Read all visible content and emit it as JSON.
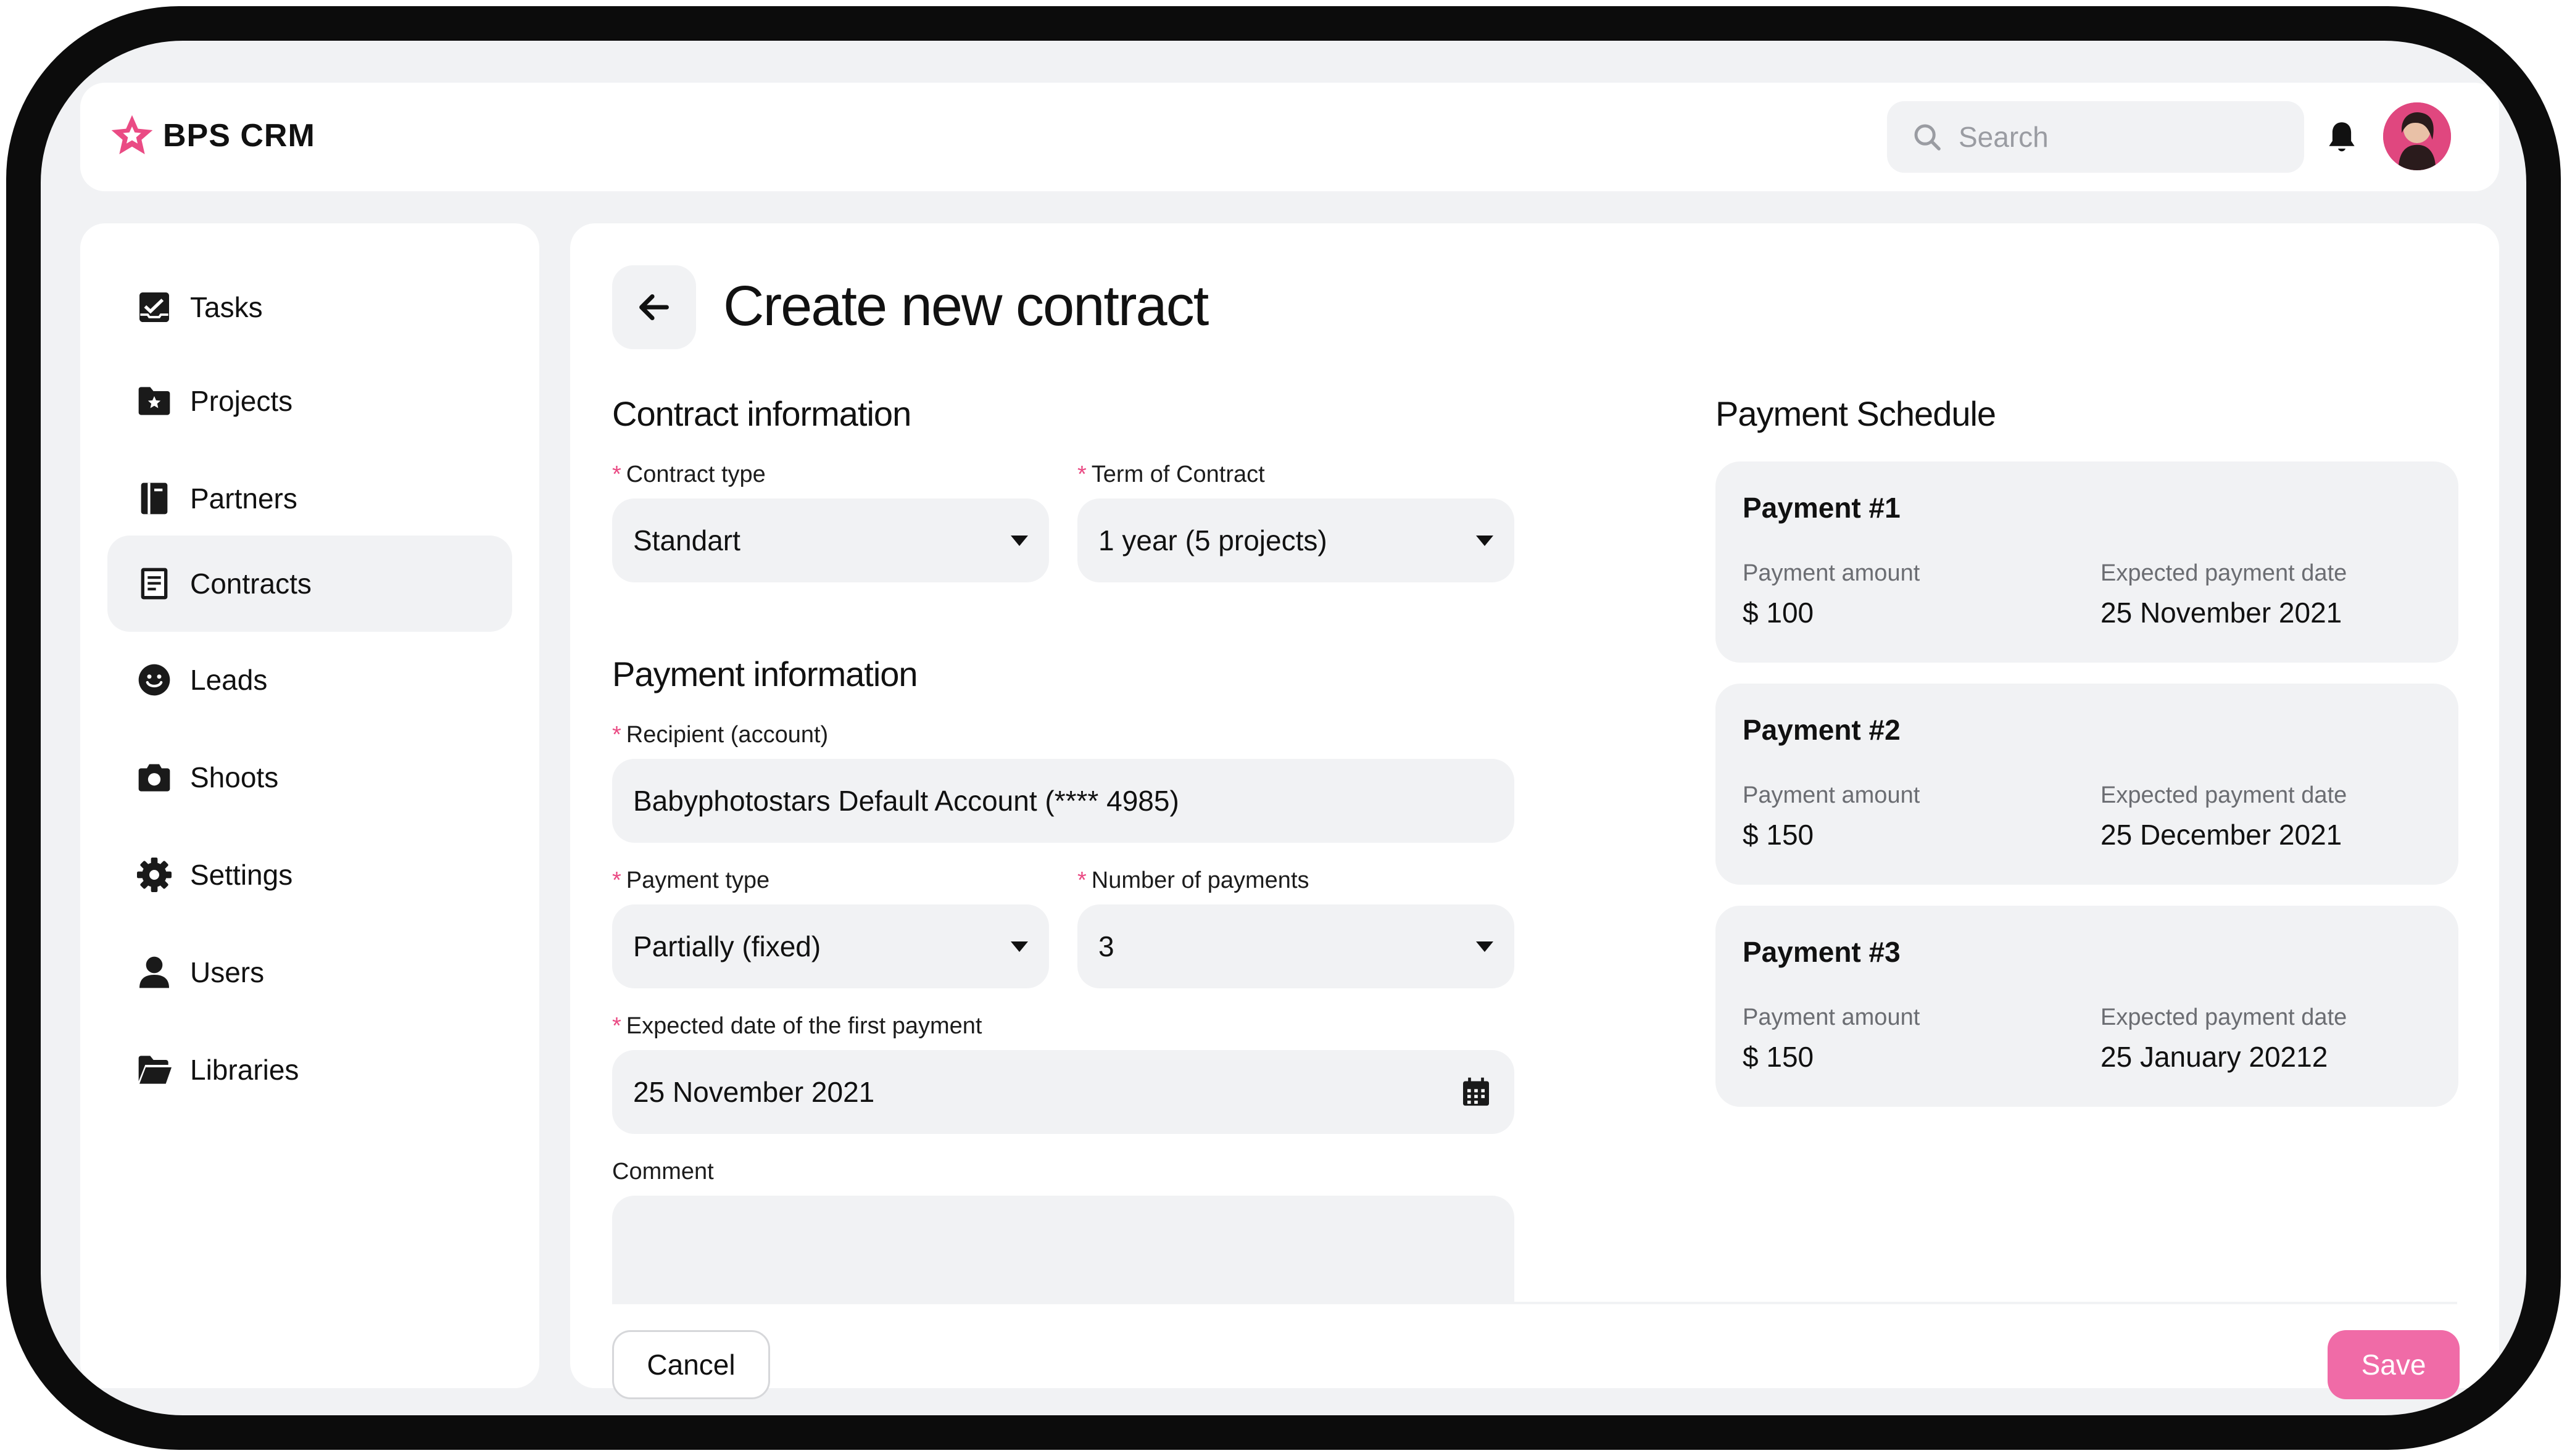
{
  "app": {
    "name": "BPS CRM"
  },
  "header": {
    "search_placeholder": "Search"
  },
  "sidebar": {
    "items": [
      {
        "label": "Tasks",
        "icon": "tasks-icon"
      },
      {
        "label": "Projects",
        "icon": "folder-star-icon"
      },
      {
        "label": "Partners",
        "icon": "book-icon"
      },
      {
        "label": "Contracts",
        "icon": "document-icon",
        "active": true
      },
      {
        "label": "Leads",
        "icon": "smiley-icon"
      },
      {
        "label": "Shoots",
        "icon": "camera-icon"
      },
      {
        "label": "Settings",
        "icon": "gear-icon"
      },
      {
        "label": "Users",
        "icon": "user-icon"
      },
      {
        "label": "Libraries",
        "icon": "folder-open-icon"
      }
    ]
  },
  "page": {
    "title": "Create new contract"
  },
  "contract_info": {
    "title": "Contract information",
    "contract_type": {
      "label": "Contract type",
      "value": "Standart"
    },
    "term": {
      "label": "Term of Contract",
      "value": "1 year (5 projects)"
    }
  },
  "payment_info": {
    "title": "Payment information",
    "recipient": {
      "label": "Recipient (account)",
      "value": "Babyphotostars Default Account (**** 4985)"
    },
    "payment_type": {
      "label": "Payment type",
      "value": "Partially (fixed)"
    },
    "num_payments": {
      "label": "Number of payments",
      "value": "3"
    },
    "first_date": {
      "label": "Expected date of the first payment",
      "value": "25 November 2021"
    },
    "comment": {
      "label": "Comment",
      "value": ""
    }
  },
  "schedule": {
    "title": "Payment Schedule",
    "amount_label": "Payment amount",
    "date_label": "Expected  payment date",
    "payments": [
      {
        "title": "Payment #1",
        "amount": "$ 100",
        "date": "25 November 2021"
      },
      {
        "title": "Payment #2",
        "amount": "$ 150",
        "date": "25 December 2021"
      },
      {
        "title": "Payment #3",
        "amount": "$ 150",
        "date": "25 January 20212"
      }
    ]
  },
  "actions": {
    "cancel": "Cancel",
    "save": "Save"
  },
  "colors": {
    "accent": "#f06ba7",
    "required": "#ea4b84",
    "surface": "#f1f2f4"
  }
}
